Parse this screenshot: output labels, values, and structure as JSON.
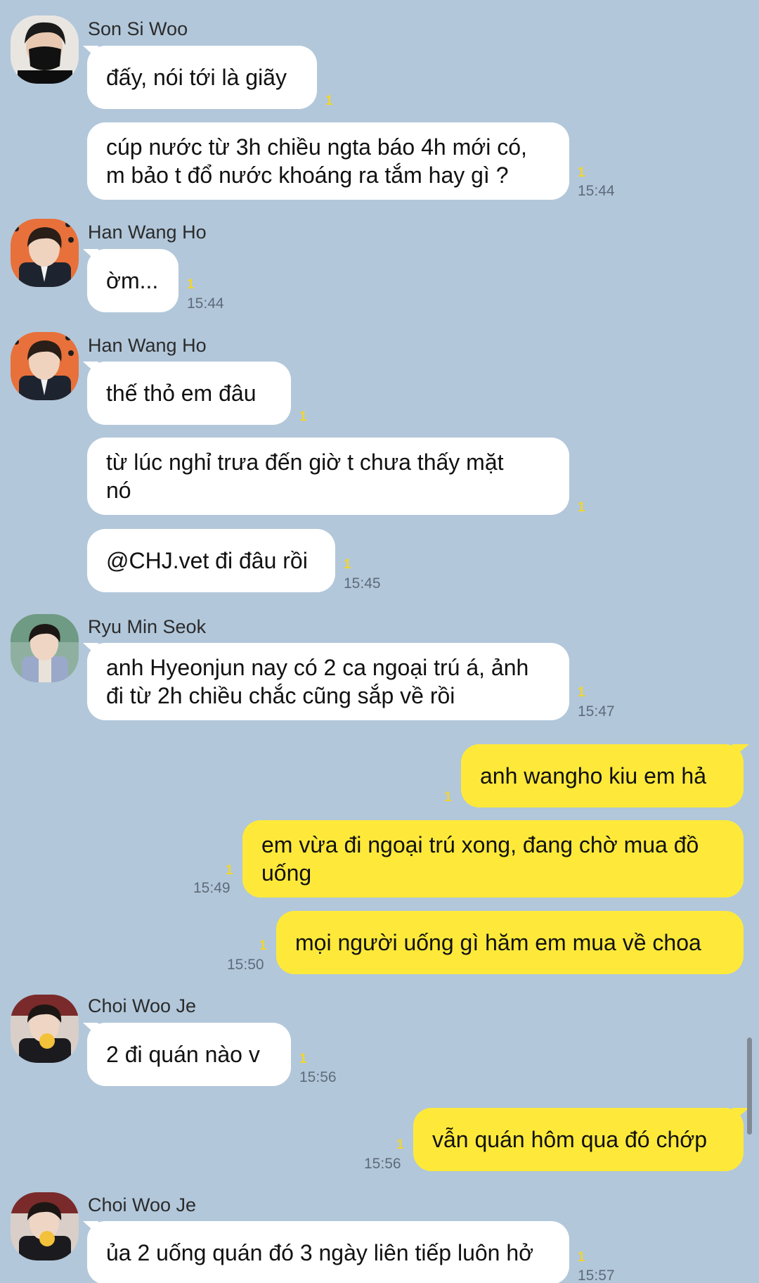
{
  "chat": {
    "messages": [
      {
        "sender": "Son Si Woo",
        "text": "đấy, nói tới là giãy",
        "unread": "1",
        "time": ""
      },
      {
        "text": "cúp nước từ 3h chiều ngta báo 4h mới có,\nm bảo t đổ nước khoáng ra tắm hay gì ?",
        "unread": "1",
        "time": "15:44"
      },
      {
        "sender": "Han Wang Ho",
        "text": "ờm...",
        "unread": "1",
        "time": "15:44"
      },
      {
        "sender": "Han Wang Ho",
        "text": "thế thỏ em đâu",
        "unread": "1",
        "time": ""
      },
      {
        "text": "từ lúc nghỉ trưa đến giờ t chưa thấy mặt\nnó",
        "unread": "1",
        "time": ""
      },
      {
        "text": "@CHJ.vet đi đâu rồi",
        "unread": "1",
        "time": "15:45"
      },
      {
        "sender": "Ryu Min Seok",
        "text": "anh Hyeonjun nay có 2 ca ngoại trú á, ảnh\nđi từ 2h chiều chắc cũng sắp về rồi",
        "unread": "1",
        "time": "15:47"
      },
      {
        "text": "anh wangho kiu em hả",
        "unread": "1",
        "time": ""
      },
      {
        "text": "em vừa đi ngoại trú xong, đang chờ mua đồ\nuống",
        "unread": "1",
        "time": "15:49"
      },
      {
        "text": "mọi người uống gì hăm em mua về choa",
        "unread": "1",
        "time": "15:50"
      },
      {
        "sender": "Choi Woo Je",
        "text": "2 đi quán nào v",
        "unread": "1",
        "time": "15:56"
      },
      {
        "text": "vẫn quán hôm qua đó chớp",
        "unread": "1",
        "time": "15:56"
      },
      {
        "sender": "Choi Woo Je",
        "text": "ủa 2 uống quán đó 3 ngày liên tiếp luôn hở",
        "unread": "1",
        "time": "15:57"
      }
    ]
  },
  "colors": {
    "background": "#b2c7da",
    "incoming_bubble": "#ffffff",
    "outgoing_bubble": "#fee93a",
    "unread": "#f2d52c",
    "timestamp": "#5d6b79"
  },
  "avatars": [
    "person-avatar",
    "person-avatar",
    "person-avatar",
    "person-avatar",
    "person-avatar",
    "person-avatar"
  ]
}
